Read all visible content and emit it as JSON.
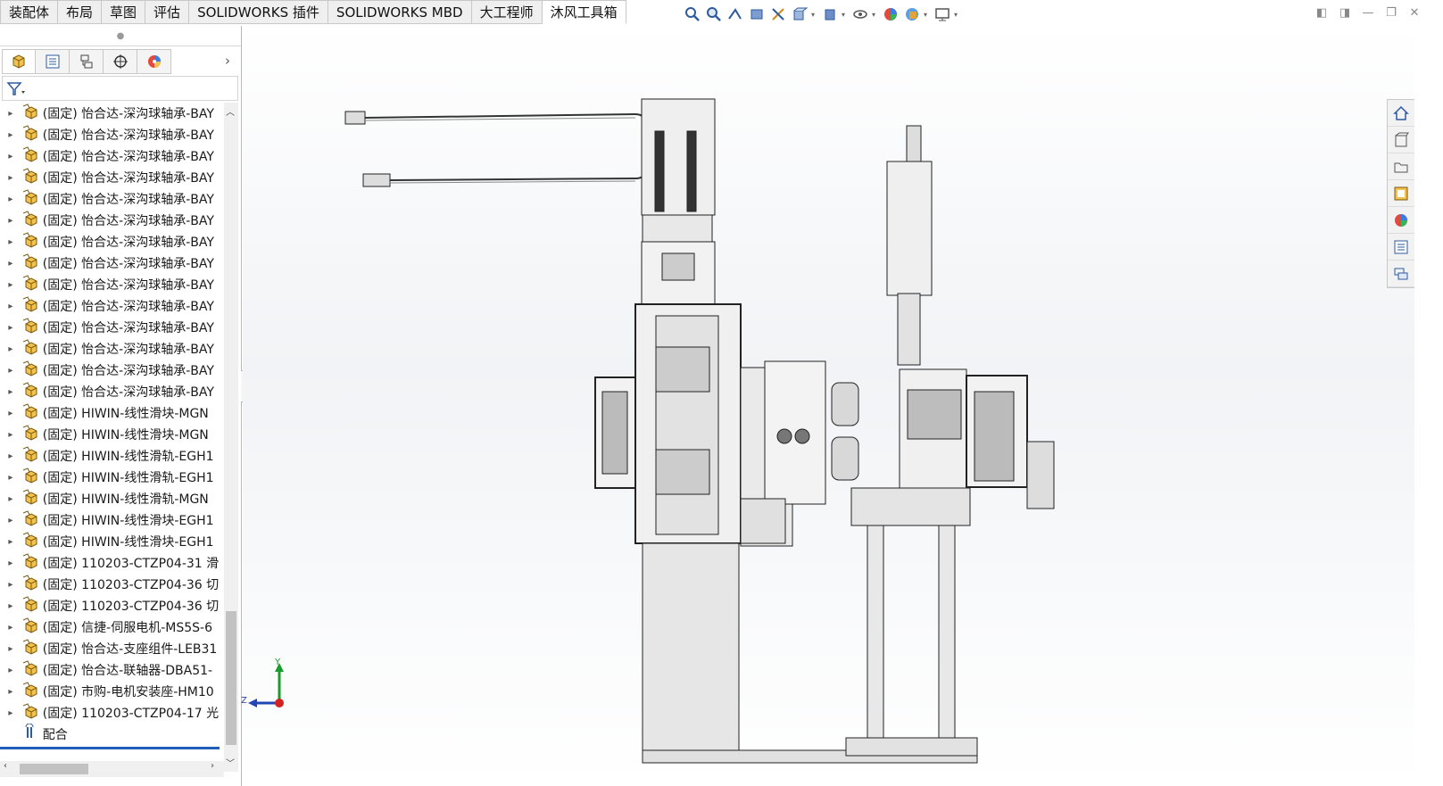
{
  "tabs": [
    {
      "label": "装配体",
      "active": false
    },
    {
      "label": "布局",
      "active": false
    },
    {
      "label": "草图",
      "active": false
    },
    {
      "label": "评估",
      "active": false
    },
    {
      "label": "SOLIDWORKS 插件",
      "active": false
    },
    {
      "label": "SOLIDWORKS MBD",
      "active": false
    },
    {
      "label": "大工程师",
      "active": false
    },
    {
      "label": "沐风工具箱",
      "active": true
    }
  ],
  "view_toolbar": [
    "zoom-to-fit-icon",
    "zoom-area-icon",
    "previous-view-icon",
    "section-view-icon",
    "dynamic-annotation-icon",
    "view-orientation-icon",
    "display-style-icon",
    "hide-show-icon",
    "edit-appearance-icon",
    "apply-scene-icon",
    "view-settings-icon"
  ],
  "panel_tabs": [
    "featuremanager-icon",
    "propertymanager-icon",
    "configurationmanager-icon",
    "dimxpert-icon",
    "displaymanager-icon"
  ],
  "tree": {
    "items": [
      {
        "label": "(固定) 怡合达-深沟球轴承-BAY"
      },
      {
        "label": "(固定) 怡合达-深沟球轴承-BAY"
      },
      {
        "label": "(固定) 怡合达-深沟球轴承-BAY"
      },
      {
        "label": "(固定) 怡合达-深沟球轴承-BAY"
      },
      {
        "label": "(固定) 怡合达-深沟球轴承-BAY"
      },
      {
        "label": "(固定) 怡合达-深沟球轴承-BAY"
      },
      {
        "label": "(固定) 怡合达-深沟球轴承-BAY"
      },
      {
        "label": "(固定) 怡合达-深沟球轴承-BAY"
      },
      {
        "label": "(固定) 怡合达-深沟球轴承-BAY"
      },
      {
        "label": "(固定) 怡合达-深沟球轴承-BAY"
      },
      {
        "label": "(固定) 怡合达-深沟球轴承-BAY"
      },
      {
        "label": "(固定) 怡合达-深沟球轴承-BAY"
      },
      {
        "label": "(固定) 怡合达-深沟球轴承-BAY"
      },
      {
        "label": "(固定) 怡合达-深沟球轴承-BAY"
      },
      {
        "label": "(固定) HIWIN-线性滑块-MGN"
      },
      {
        "label": "(固定) HIWIN-线性滑块-MGN"
      },
      {
        "label": "(固定) HIWIN-线性滑轨-EGH1"
      },
      {
        "label": "(固定) HIWIN-线性滑轨-EGH1"
      },
      {
        "label": "(固定) HIWIN-线性滑轨-MGN"
      },
      {
        "label": "(固定) HIWIN-线性滑块-EGH1"
      },
      {
        "label": "(固定) HIWIN-线性滑块-EGH1"
      },
      {
        "label": "(固定) 110203-CTZP04-31 滑"
      },
      {
        "label": "(固定) 110203-CTZP04-36 切"
      },
      {
        "label": "(固定) 110203-CTZP04-36 切"
      },
      {
        "label": "(固定) 信捷-伺服电机-MS5S-6"
      },
      {
        "label": "(固定) 怡合达-支座组件-LEB31"
      },
      {
        "label": "(固定) 怡合达-联轴器-DBA51-"
      },
      {
        "label": "(固定) 市购-电机安装座-HM10"
      },
      {
        "label": "(固定) 110203-CTZP04-17 光"
      }
    ],
    "mates_label": "配合"
  },
  "triad": {
    "y": "Y",
    "z": "Z"
  },
  "task_pane": [
    "home-icon",
    "design-library-icon",
    "file-explorer-icon",
    "view-palette-icon",
    "appearances-icon",
    "custom-properties-icon",
    "forum-icon"
  ]
}
